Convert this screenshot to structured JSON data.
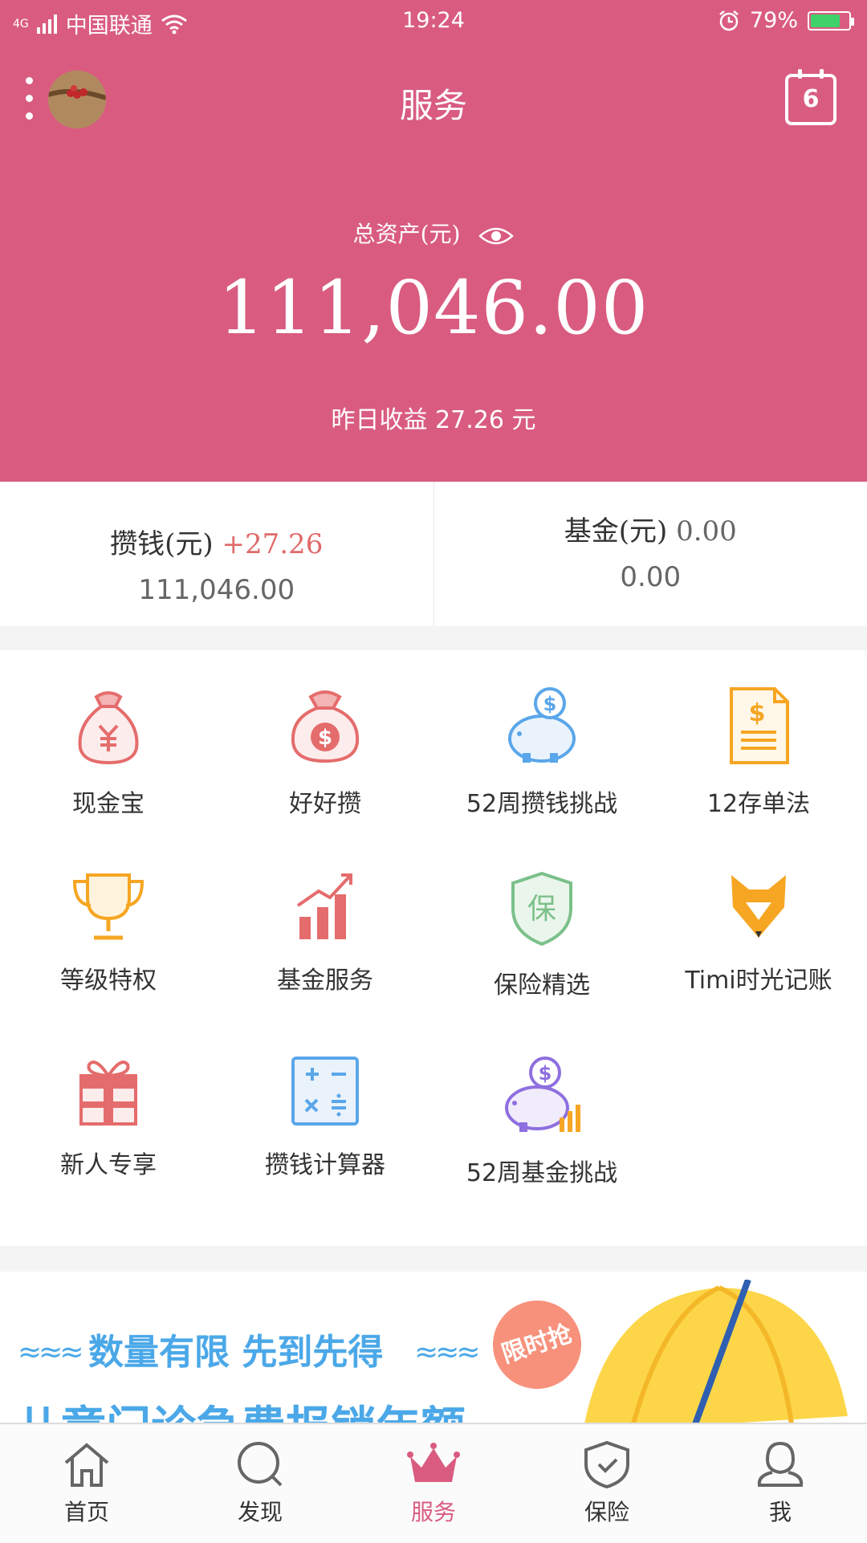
{
  "status": {
    "network": "4G",
    "carrier": "中国联通",
    "time": "19:24",
    "battery": "79%",
    "battery_level": 0.79
  },
  "header": {
    "title": "服务",
    "calendar_day": "6"
  },
  "assets": {
    "label": "总资产(元)",
    "value": "111,046.00",
    "yesterday": "昨日收益 27.26 元"
  },
  "summary": {
    "save": {
      "label": "攒钱(元)",
      "delta": "+27.26",
      "value": "111,046.00"
    },
    "fund": {
      "label": "基金(元)",
      "delta": "0.00",
      "value": "0.00"
    }
  },
  "services": [
    {
      "label": "现金宝",
      "icon": "money-bag-yuan-icon"
    },
    {
      "label": "好好攒",
      "icon": "money-bag-dollar-icon"
    },
    {
      "label": "52周攒钱挑战",
      "icon": "piggy-bank-icon"
    },
    {
      "label": "12存单法",
      "icon": "deposit-document-icon"
    },
    {
      "label": "等级特权",
      "icon": "trophy-icon"
    },
    {
      "label": "基金服务",
      "icon": "growth-chart-icon"
    },
    {
      "label": "保险精选",
      "icon": "insurance-shield-icon"
    },
    {
      "label": "Timi时光记账",
      "icon": "fox-icon"
    },
    {
      "label": "新人专享",
      "icon": "gift-icon"
    },
    {
      "label": "攒钱计算器",
      "icon": "calculator-icon"
    },
    {
      "label": "52周基金挑战",
      "icon": "piggy-bank-chart-icon"
    }
  ],
  "banner": {
    "slogan": "数量有限 先到先得",
    "badge": "限时抢",
    "subtitle": "儿童门诊急费报销年额"
  },
  "tabs": [
    {
      "label": "首页",
      "icon": "home-icon"
    },
    {
      "label": "发现",
      "icon": "search-icon"
    },
    {
      "label": "服务",
      "icon": "crown-icon",
      "active": true
    },
    {
      "label": "保险",
      "icon": "shield-icon"
    },
    {
      "label": "我",
      "icon": "user-icon"
    }
  ],
  "colors": {
    "brand": "#d95c80",
    "red_icon": "#e56c6c",
    "blue_icon": "#5aa6ea",
    "orange_icon": "#f6a623",
    "green_icon": "#7cc08a"
  }
}
